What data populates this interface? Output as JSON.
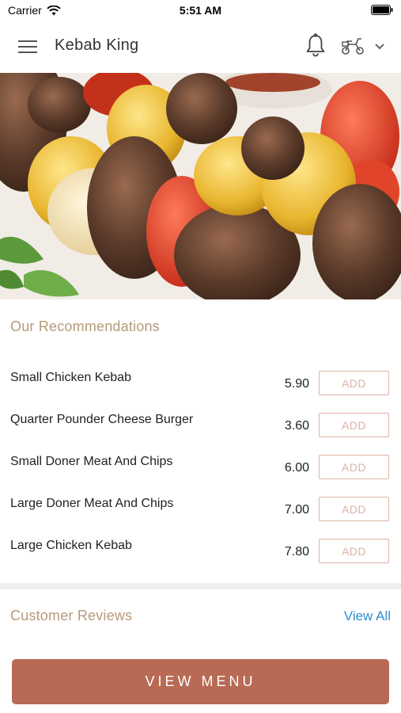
{
  "status_bar": {
    "carrier": "Carrier",
    "time": "5:51 AM"
  },
  "header": {
    "title": "Kebab King"
  },
  "recommendations": {
    "title": "Our Recommendations",
    "items": [
      {
        "name": "Small Chicken Kebab",
        "price": "5.90",
        "button": "ADD"
      },
      {
        "name": "Quarter Pounder Cheese Burger",
        "price": "3.60",
        "button": "ADD"
      },
      {
        "name": "Small Doner Meat And Chips",
        "price": "6.00",
        "button": "ADD"
      },
      {
        "name": "Large Doner Meat And Chips",
        "price": "7.00",
        "button": "ADD"
      },
      {
        "name": "Large Chicken Kebab",
        "price": "7.80",
        "button": "ADD"
      }
    ]
  },
  "reviews": {
    "title": "Customer Reviews",
    "view_all": "View All"
  },
  "footer": {
    "view_menu": "VIEW MENU"
  },
  "colors": {
    "accent": "#b86a55",
    "section_title": "#b79a7a",
    "add_border": "#dfb3a7",
    "link": "#2f8fd0"
  },
  "icons": [
    "wifi-icon",
    "battery-icon",
    "hamburger-menu-icon",
    "bell-icon",
    "scooter-icon",
    "chevron-down-icon"
  ]
}
